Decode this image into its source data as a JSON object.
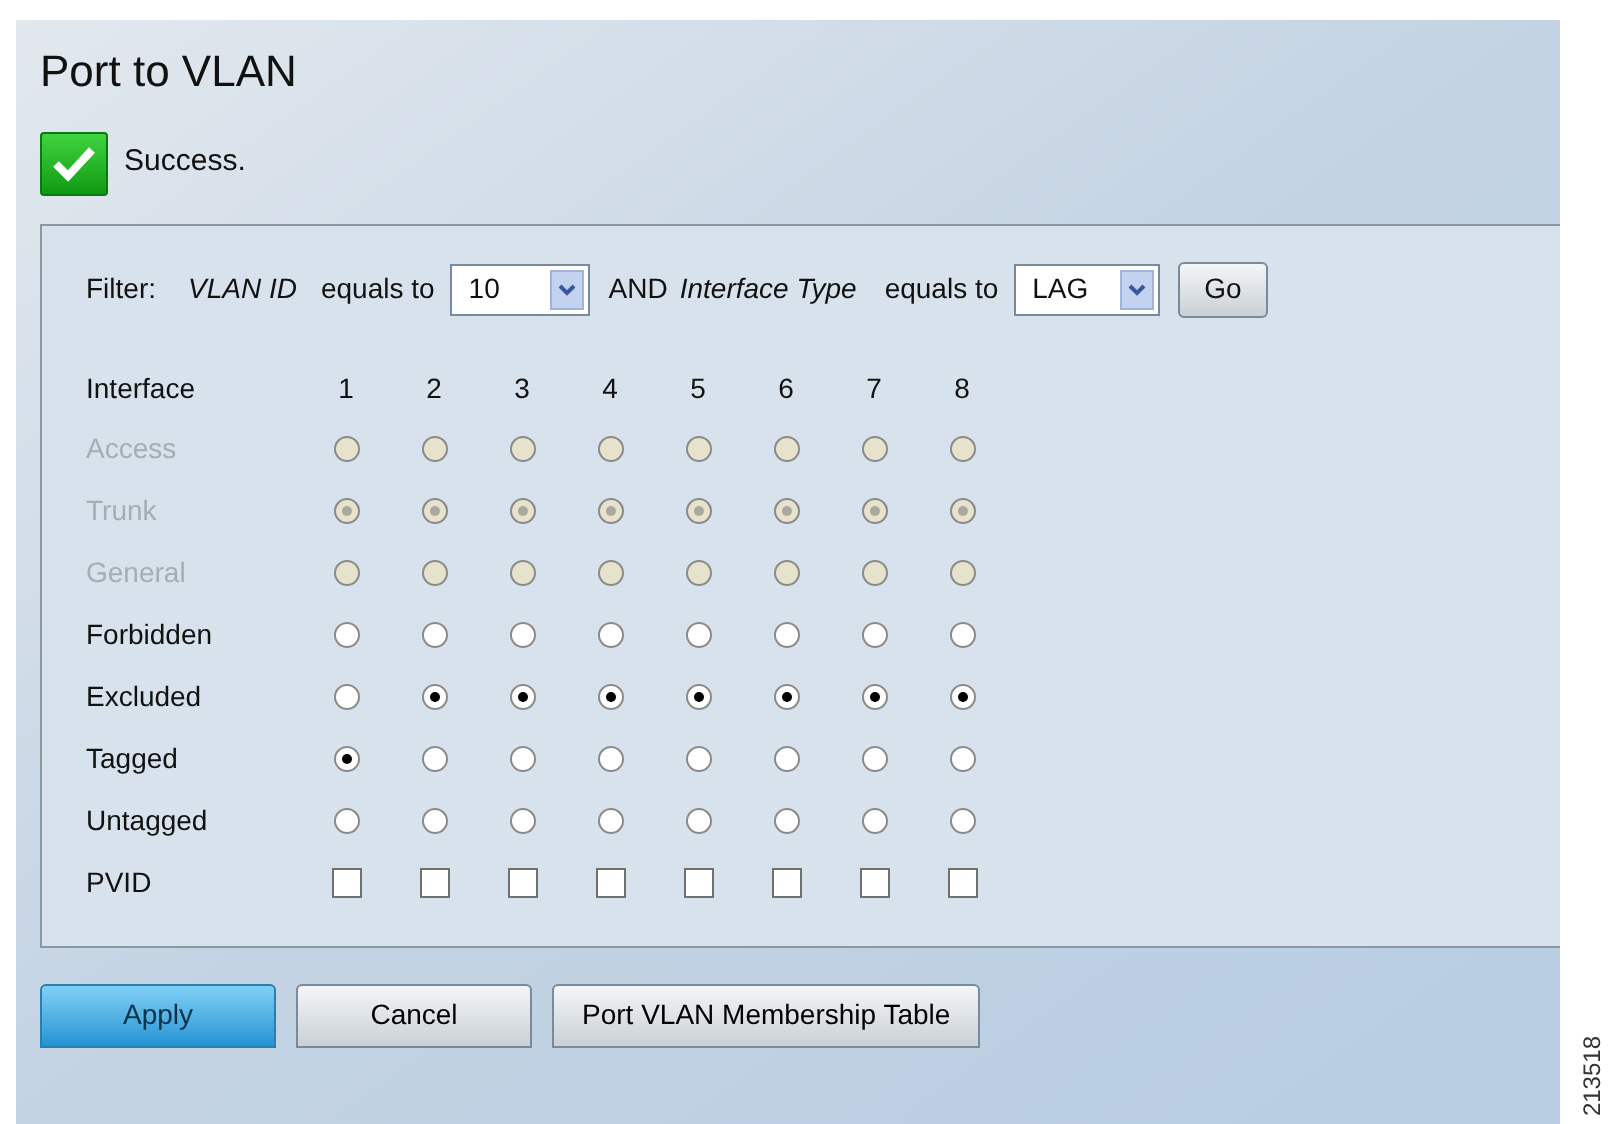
{
  "title": "Port to VLAN",
  "status": {
    "kind": "success",
    "message": "Success."
  },
  "filter": {
    "label": "Filter:",
    "field_1": "VLAN ID",
    "op_1": "equals to",
    "value_1": "10",
    "joiner": "AND",
    "field_2": "Interface Type",
    "op_2": "equals to",
    "value_2": "LAG",
    "go": "Go"
  },
  "table": {
    "header": "Interface",
    "columns": [
      "1",
      "2",
      "3",
      "4",
      "5",
      "6",
      "7",
      "8"
    ],
    "rows": [
      {
        "label": "Access",
        "kind": "radio",
        "disabled": true,
        "cells": [
          {
            "selected": false
          },
          {
            "selected": false
          },
          {
            "selected": false
          },
          {
            "selected": false
          },
          {
            "selected": false
          },
          {
            "selected": false
          },
          {
            "selected": false
          },
          {
            "selected": false
          }
        ]
      },
      {
        "label": "Trunk",
        "kind": "radio",
        "disabled": true,
        "cells": [
          {
            "selected": true
          },
          {
            "selected": true
          },
          {
            "selected": true
          },
          {
            "selected": true
          },
          {
            "selected": true
          },
          {
            "selected": true
          },
          {
            "selected": true
          },
          {
            "selected": true
          }
        ]
      },
      {
        "label": "General",
        "kind": "radio",
        "disabled": true,
        "cells": [
          {
            "selected": false
          },
          {
            "selected": false
          },
          {
            "selected": false
          },
          {
            "selected": false
          },
          {
            "selected": false
          },
          {
            "selected": false
          },
          {
            "selected": false
          },
          {
            "selected": false
          }
        ]
      },
      {
        "label": "Forbidden",
        "kind": "radio",
        "disabled": false,
        "cells": [
          {
            "selected": false
          },
          {
            "selected": false
          },
          {
            "selected": false
          },
          {
            "selected": false
          },
          {
            "selected": false
          },
          {
            "selected": false
          },
          {
            "selected": false
          },
          {
            "selected": false
          }
        ]
      },
      {
        "label": "Excluded",
        "kind": "radio",
        "disabled": false,
        "cells": [
          {
            "selected": false
          },
          {
            "selected": true
          },
          {
            "selected": true
          },
          {
            "selected": true
          },
          {
            "selected": true
          },
          {
            "selected": true
          },
          {
            "selected": true
          },
          {
            "selected": true
          }
        ]
      },
      {
        "label": "Tagged",
        "kind": "radio",
        "disabled": false,
        "cells": [
          {
            "selected": true
          },
          {
            "selected": false
          },
          {
            "selected": false
          },
          {
            "selected": false
          },
          {
            "selected": false
          },
          {
            "selected": false
          },
          {
            "selected": false
          },
          {
            "selected": false
          }
        ]
      },
      {
        "label": "Untagged",
        "kind": "radio",
        "disabled": false,
        "cells": [
          {
            "selected": false
          },
          {
            "selected": false
          },
          {
            "selected": false
          },
          {
            "selected": false
          },
          {
            "selected": false
          },
          {
            "selected": false
          },
          {
            "selected": false
          },
          {
            "selected": false
          }
        ]
      },
      {
        "label": "PVID",
        "kind": "checkbox",
        "disabled": false,
        "cells": [
          {
            "checked": false
          },
          {
            "checked": false
          },
          {
            "checked": false
          },
          {
            "checked": false
          },
          {
            "checked": false
          },
          {
            "checked": false
          },
          {
            "checked": false
          },
          {
            "checked": false
          }
        ]
      }
    ]
  },
  "buttons": [
    {
      "label": "Apply",
      "kind": "primary"
    },
    {
      "label": "Cancel",
      "kind": "secondary"
    },
    {
      "label": "Port VLAN Membership Table",
      "kind": "secondary"
    }
  ],
  "figure_number": "213518"
}
